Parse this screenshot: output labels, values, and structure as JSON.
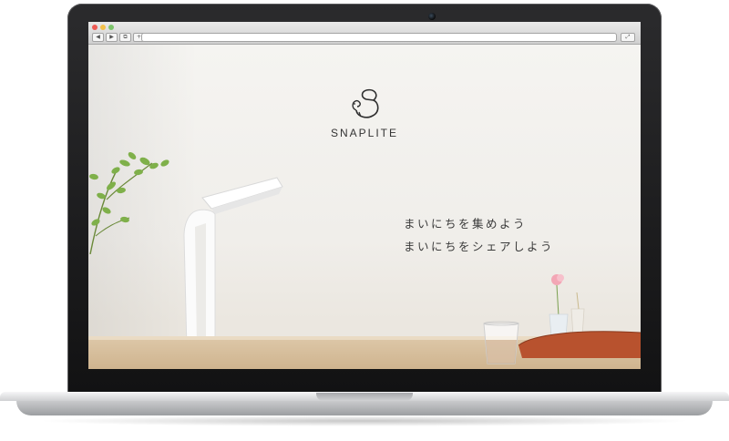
{
  "browser": {
    "nav_back": "◀",
    "nav_forward": "▶",
    "bookmarks": "⧉",
    "add_tab": "+",
    "reader": "⤢",
    "url": ""
  },
  "site": {
    "brand": "SNAPLITE",
    "tagline_line1": "まいにちを集めよう",
    "tagline_line2": "まいにちをシェアしよう"
  },
  "icons": {
    "logo": "snaplite-logo-icon",
    "close": "close-dot-icon",
    "minimize": "minimize-dot-icon",
    "zoom": "zoom-dot-icon"
  },
  "colors": {
    "page_bg": "#f2f0ec",
    "text": "#3a3a3a",
    "bezel": "#1a1a1b",
    "aluminum": "#c9cacc"
  }
}
